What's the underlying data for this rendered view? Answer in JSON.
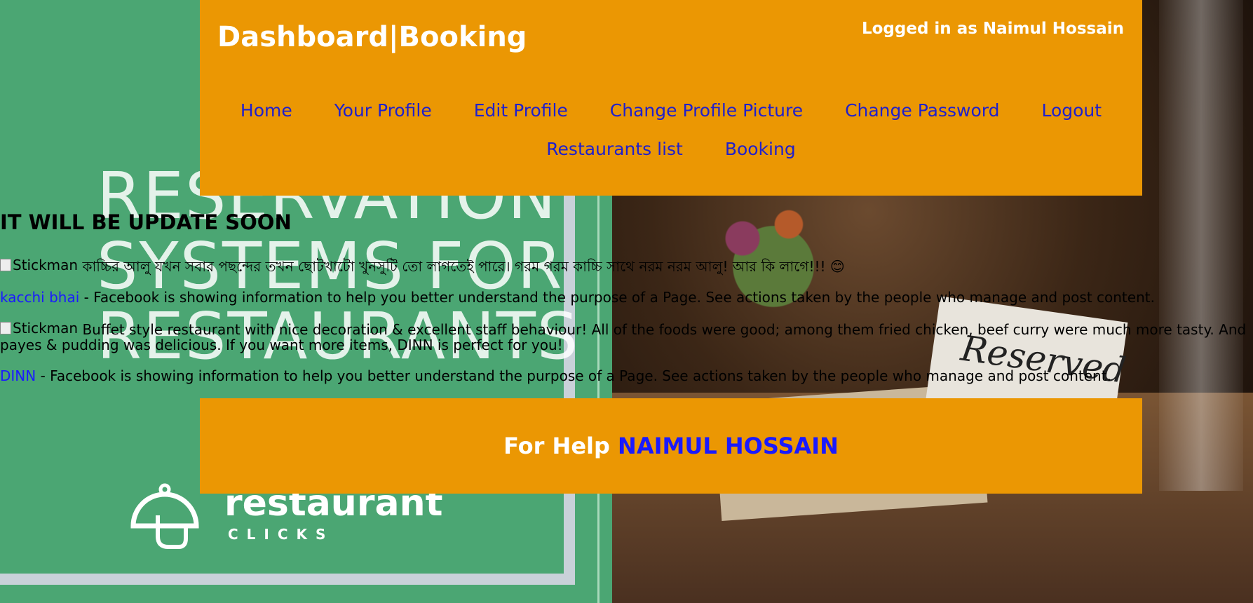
{
  "header": {
    "brand": "Dashboard|Booking",
    "logged_in": "Logged in as Naimul Hossain"
  },
  "nav": {
    "items": [
      "Home",
      "Your Profile",
      "Edit Profile",
      "Change Profile Picture",
      "Change Password",
      "Logout",
      "Restaurants list",
      "Booking"
    ]
  },
  "background": {
    "poster_lines": [
      "RESERVATION",
      "SYSTEMS FOR",
      "RESTAURANTS"
    ],
    "logo_word": "restaurant",
    "logo_sub": "CLICKS",
    "card_text": "Reserved"
  },
  "content": {
    "heading": "IT WILL BE UPDATE SOON",
    "posts": [
      {
        "alt": "Stickman",
        "text": "কাচ্চির আলু যখন সবার পছন্দের তখন ছোটখাটো খুনসুটি তো লাগতেই পারে। গরম গরম কাচ্চি সাথে নরম নরম আলু! আর কি লাগে!!! 😊",
        "link": "kacchi bhai",
        "link_text": " - Facebook is showing information to help you better understand the purpose of a Page. See actions taken by the people who manage and post content."
      },
      {
        "alt": "Stickman",
        "text": "Buffet style restaurant with nice decoration & excellent staff behaviour! All of the foods were good; among them fried chicken, beef curry were much more tasty. And",
        "text_cont": "payes & pudding was delicious. If you want more items, DINN is perfect for you!",
        "link": "DINN",
        "link_text": " - Facebook is showing information to help you better understand the purpose of a Page. See actions taken by the people who manage and post content."
      }
    ]
  },
  "footer": {
    "prefix": "For Help",
    "name": "NAIMUL HOSSAIN"
  },
  "colors": {
    "accent": "#eb9703",
    "link": "#1a1aff",
    "nav_link": "#2020cc",
    "poster_green": "#4ba673"
  }
}
